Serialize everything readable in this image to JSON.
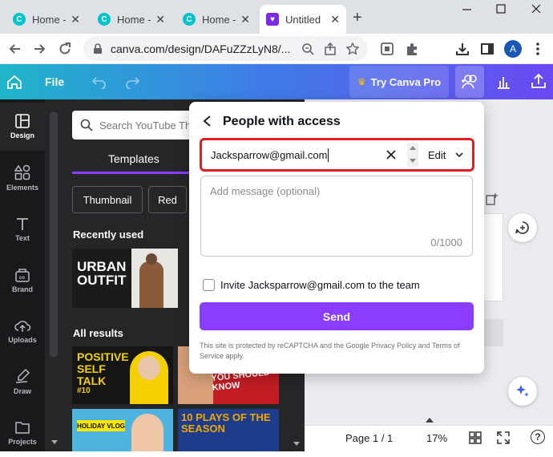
{
  "tabs": [
    {
      "label": "Home -"
    },
    {
      "label": "Home -"
    },
    {
      "label": "Home -"
    },
    {
      "label": "Untitled"
    }
  ],
  "browser": {
    "url": "canva.com/design/DAFuZZzLyN8/...",
    "avatar_letter": "A"
  },
  "canva_header": {
    "file_label": "File",
    "try_pro_label": "Try Canva Pro"
  },
  "rail": [
    {
      "label": "Design"
    },
    {
      "label": "Elements"
    },
    {
      "label": "Text"
    },
    {
      "label": "Brand"
    },
    {
      "label": "Uploads"
    },
    {
      "label": "Draw"
    },
    {
      "label": "Projects"
    }
  ],
  "panel": {
    "search_placeholder": "Search YouTube Th",
    "templates_tab": "Templates",
    "chips": [
      "Thumbnail",
      "Red"
    ],
    "recently_used": "Recently used",
    "all_results": "All results",
    "thumbs": {
      "urban": "URBAN OUTFIT",
      "positive": "POSITIVE SELF TALK",
      "positive_num": "#10",
      "you_should": "YOU SHOULD KNOW",
      "holiday": "HOLIDAY VLOG",
      "plays": "10 PLAYS OF THE SEASON"
    }
  },
  "bottom": {
    "page": "Page 1 / 1",
    "zoom": "17%"
  },
  "dialog": {
    "title": "People with access",
    "email_value": "Jacksparrow@gmail.com",
    "permission": "Edit",
    "message_placeholder": "Add message (optional)",
    "counter": "0/1000",
    "invite_label": "Invite Jacksparrow@gmail.com to the team",
    "send_label": "Send",
    "disclaimer": "This site is protected by reCAPTCHA and the Google Privacy Policy and Terms of Service apply."
  },
  "colors": {
    "accent": "#8b3dff",
    "highlight": "#e02020",
    "rail_bg": "#18191b",
    "panel_bg": "#252627"
  }
}
